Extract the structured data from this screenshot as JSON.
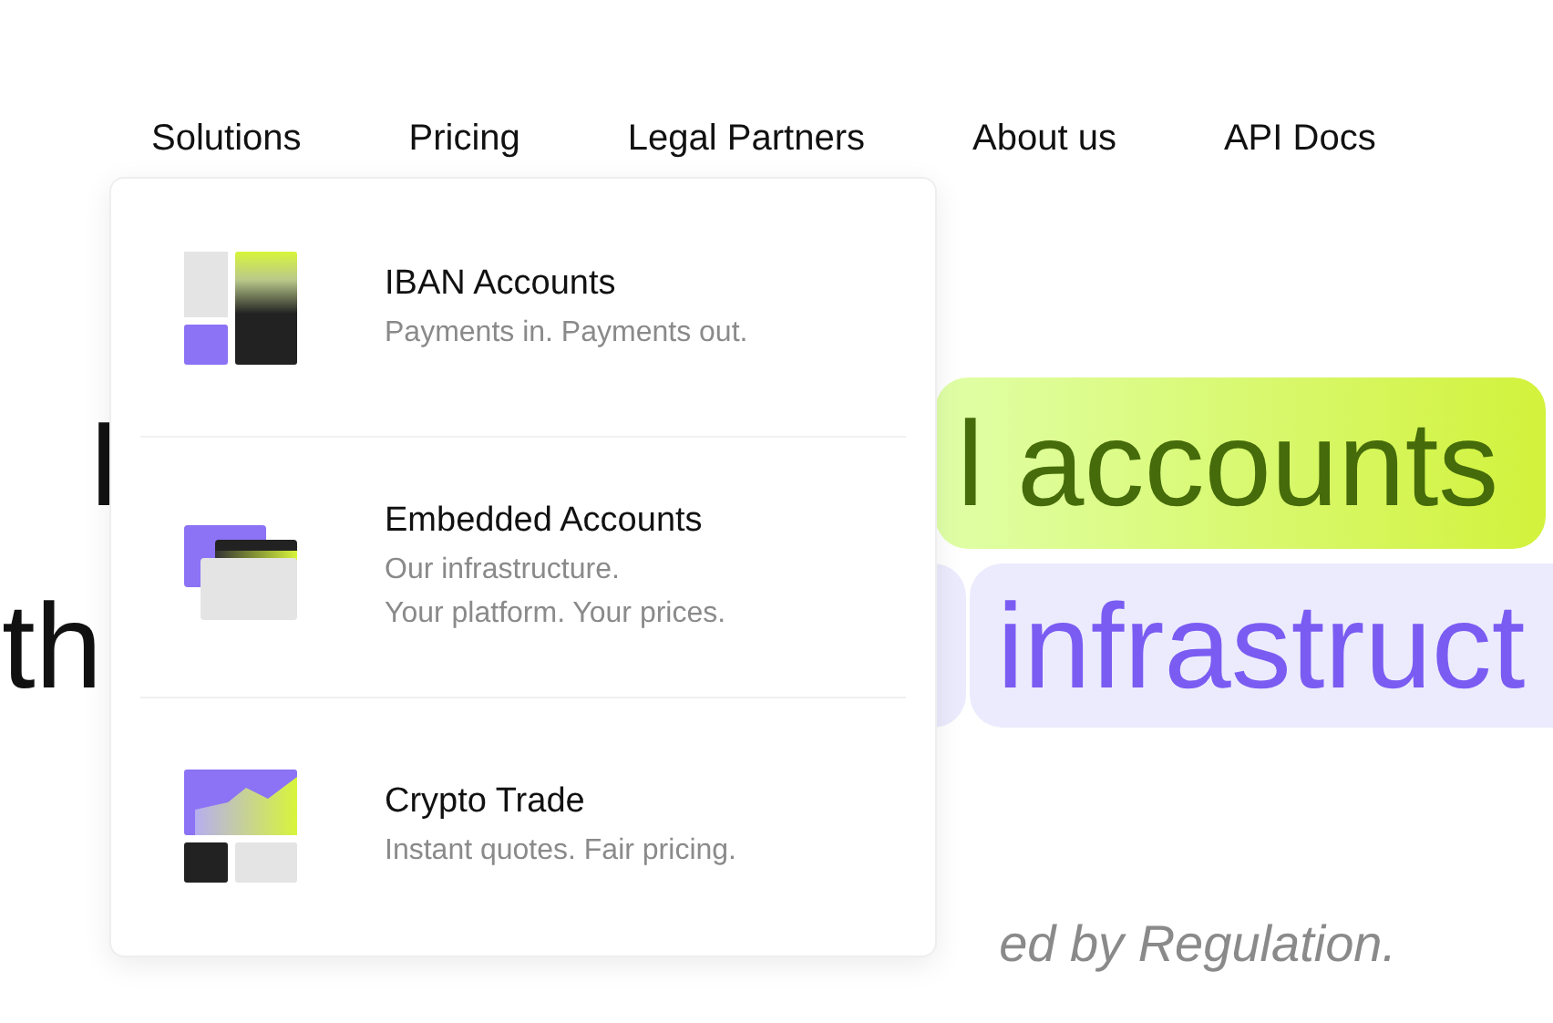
{
  "nav": [
    {
      "label": "Solutions"
    },
    {
      "label": "Pricing"
    },
    {
      "label": "Legal Partners"
    },
    {
      "label": "About us"
    },
    {
      "label": "API Docs"
    }
  ],
  "headline": {
    "line_1": {
      "start": "I",
      "highlight": "l accounts"
    },
    "line_2": {
      "start": "th",
      "highlight": "infrastruct"
    }
  },
  "tagline": [
    "ed by Regulation."
  ],
  "dropdown": [
    {
      "kind": "blocks",
      "title": "IBAN Accounts",
      "lines": [
        "Payments in. Payments out."
      ]
    },
    {
      "kind": "cards",
      "title": "Embedded Accounts",
      "lines": [
        "Our infrastructure.",
        "Your platform. Your prices."
      ]
    },
    {
      "kind": "chart",
      "title": "Crypto Trade",
      "lines": [
        "Instant quotes. Fair pricing."
      ]
    }
  ]
}
